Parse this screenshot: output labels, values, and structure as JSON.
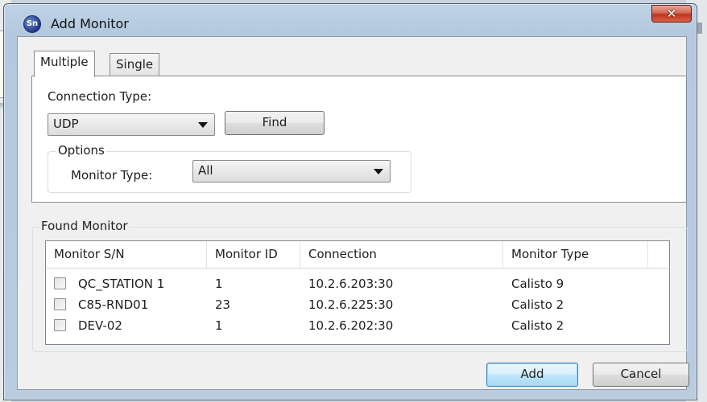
{
  "window": {
    "title": "Add Monitor",
    "close_glyph": "✕",
    "icon_letters": "Sn"
  },
  "tabs": [
    {
      "label": "Multiple",
      "active": true
    },
    {
      "label": "Single",
      "active": false
    }
  ],
  "connection": {
    "label": "Connection Type:",
    "value": "UDP",
    "find_label": "Find"
  },
  "options": {
    "legend": "Options",
    "monitor_type_label": "Monitor Type:",
    "monitor_type_value": "All"
  },
  "found": {
    "legend": "Found Monitor",
    "columns": [
      "Monitor S/N",
      "Monitor ID",
      "Connection",
      "Monitor Type"
    ],
    "rows": [
      {
        "sn": "QC_STATION 1",
        "id": "1",
        "connection": "10.2.6.203:30",
        "type": "Calisto 9",
        "checked": false
      },
      {
        "sn": "C85-RND01",
        "id": "23",
        "connection": "10.2.6.225:30",
        "type": "Calisto 2",
        "checked": false
      },
      {
        "sn": "DEV-02",
        "id": "1",
        "connection": "10.2.6.202:30",
        "type": "Calisto 2",
        "checked": false
      }
    ]
  },
  "buttons": {
    "add": "Add",
    "cancel": "Cancel"
  },
  "colors": {
    "title_bar": "#b9cce0",
    "close_button": "#c0341d",
    "primary_button": "#bee6fd"
  }
}
